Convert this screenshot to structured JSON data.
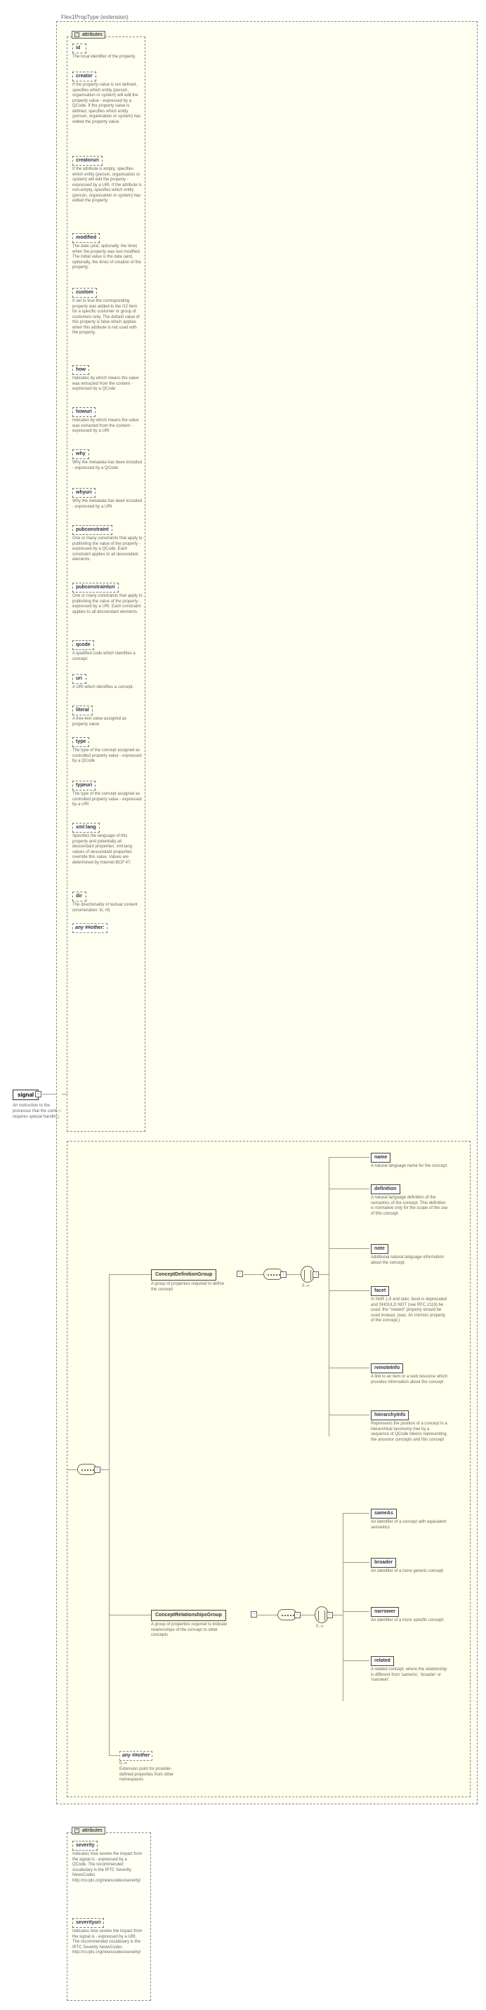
{
  "diagram": {
    "extension_label": "Flex1PropType (extension)",
    "attributes_label": "attributes",
    "root": {
      "name": "signal",
      "doc": "An instruction to the processor that the content requires special handling."
    },
    "base_attrs": [
      {
        "name": "id",
        "doc": "The local identifier of the property."
      },
      {
        "name": "creator",
        "doc": "If the property value is not defined, specifies which entity (person, organisation or system) will edit the property value - expressed by a QCode. If the property value is defined, specifies which entity (person, organisation or system) has edited the property value."
      },
      {
        "name": "creatoruri",
        "doc": "If the attribute is empty, specifies which entity (person, organisation or system) will edit the property - expressed by a URI. If the attribute is non-empty, specifies which entity (person, organisation or system) has edited the property."
      },
      {
        "name": "modified",
        "doc": "The date (and, optionally, the time) when the property was last modified. The initial value is the date (and, optionally, the time) of creation of the property."
      },
      {
        "name": "custom",
        "doc": "If set to true the corresponding property was added to the G2 Item for a specific customer or group of customers only. The default value of this property is false which applies when this attribute is not used with the property."
      },
      {
        "name": "how",
        "doc": "Indicates by which means the value was extracted from the content - expressed by a QCode"
      },
      {
        "name": "howuri",
        "doc": "Indicates by which means the value was extracted from the content - expressed by a URI"
      },
      {
        "name": "why",
        "doc": "Why the metadata has been included - expressed by a QCode"
      },
      {
        "name": "whyuri",
        "doc": "Why the metadata has been included - expressed by a URI"
      },
      {
        "name": "pubconstraint",
        "doc": "One or many constraints that apply to publishing the value of the property - expressed by a QCode. Each constraint applies to all descendant elements."
      },
      {
        "name": "pubconstrainturi",
        "doc": "One or many constraints that apply to publishing the value of the property - expressed by a URI. Each constraint applies to all descendant elements."
      },
      {
        "name": "qcode",
        "doc": "A qualified code which identifies a concept."
      },
      {
        "name": "uri",
        "doc": "A URI which identifies a concept."
      },
      {
        "name": "literal",
        "doc": "A free-text value assigned as property value."
      },
      {
        "name": "type",
        "doc": "The type of the concept assigned as controlled property value - expressed by a QCode"
      },
      {
        "name": "typeuri",
        "doc": "The type of the concept assigned as controlled property value - expressed by a URI"
      },
      {
        "name": "xml:lang",
        "doc": "Specifies the language of this property and potentially all descendant properties. xml:lang values of descendant properties override this value. Values are determined by Internet BCP 47."
      },
      {
        "name": "dir",
        "doc": "The directionality of textual content (enumeration: ltr, rtl)"
      }
    ],
    "base_any": "any ##other:",
    "groups": {
      "def_group": {
        "name": "ConceptDefinitionGroup",
        "doc": "A group of properties required to define the concept",
        "mult": "0..∞"
      },
      "rel_group": {
        "name": "ConceptRelationshipsGroup",
        "doc": "A group of properties required to indicate relationships of the concept to other concepts",
        "mult": "0..∞"
      }
    },
    "def_children": [
      {
        "name": "name",
        "doc": "A natural language name for the concept."
      },
      {
        "name": "definition",
        "doc": "A natural language definition of the semantics of the concept. This definition is normative only for the scope of the use of this concept."
      },
      {
        "name": "note",
        "doc": "Additional natural language information about the concept."
      },
      {
        "name": "facet",
        "doc": "In NAR 1.8 and later, facet is deprecated and SHOULD NOT (see RFC 2119) be used, the \"related\" property should be used instead. (was: An intrinsic property of the concept.)"
      },
      {
        "name": "remoteInfo",
        "doc": "A link to an item or a web resource which provides information about the concept"
      },
      {
        "name": "hierarchyInfo",
        "doc": "Represents the position of a concept in a hierarchical taxonomy tree by a sequence of QCode tokens representing the ancestor concepts and this concept"
      }
    ],
    "rel_children": [
      {
        "name": "sameAs",
        "doc": "An identifier of a concept with equivalent semantics"
      },
      {
        "name": "broader",
        "doc": "An identifier of a more generic concept."
      },
      {
        "name": "narrower",
        "doc": "An identifier of a more specific concept."
      },
      {
        "name": "related",
        "doc": "A related concept, where the relationship is different from 'sameAs', 'broader' or 'narrower'."
      }
    ],
    "inner_any": {
      "label": "any ##other",
      "mult": "0..∞",
      "doc": "Extension point for provider-defined properties from other namespaces"
    },
    "signal_attrs_label": "attributes",
    "signal_attrs": [
      {
        "name": "severity",
        "doc": "Indicates how severe the impact from the signal is - expressed by a QCode. The recommended vocabulary is the IPTC Severity NewsCodes http://cv.iptc.org/newscodes/severity/"
      },
      {
        "name": "severityuri",
        "doc": "Indicates how severe the impact from the signal is - expressed by a URI. The recommended vocabulary is the IPTC Severity NewsCodes http://cv.iptc.org/newscodes/severity/"
      }
    ]
  }
}
